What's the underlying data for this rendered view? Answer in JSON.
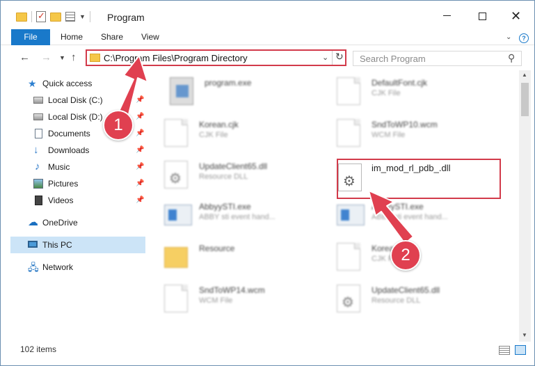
{
  "window": {
    "title": "Program",
    "close_glyph": "✕"
  },
  "ribbon": {
    "file_tab": "File",
    "tabs": [
      "Home",
      "Share",
      "View"
    ]
  },
  "address_bar": {
    "path": "C:\\Program Files\\Program Directory"
  },
  "search": {
    "placeholder": "Search Program"
  },
  "sidebar": {
    "items": [
      {
        "label": "Quick access",
        "icon": "star-icon",
        "pinned": false
      },
      {
        "label": "Local Disk (C:)",
        "icon": "disk-icon",
        "pinned": true
      },
      {
        "label": "Local Disk (D:)",
        "icon": "disk-icon",
        "pinned": true
      },
      {
        "label": "Documents",
        "icon": "documents-icon",
        "pinned": true
      },
      {
        "label": "Downloads",
        "icon": "downloads-icon",
        "pinned": true
      },
      {
        "label": "Music",
        "icon": "music-icon",
        "pinned": true
      },
      {
        "label": "Pictures",
        "icon": "pictures-icon",
        "pinned": true
      },
      {
        "label": "Videos",
        "icon": "videos-icon",
        "pinned": true
      },
      {
        "label": "OneDrive",
        "icon": "onedrive-icon",
        "pinned": false
      },
      {
        "label": "This PC",
        "icon": "this-pc-icon",
        "pinned": false,
        "selected": true
      },
      {
        "label": "Network",
        "icon": "network-icon",
        "pinned": false
      }
    ]
  },
  "files": [
    {
      "name": "program.exe",
      "type": "",
      "icon": "exe-icon"
    },
    {
      "name": "DefaultFont.cjk",
      "type": "CJK File",
      "icon": "file-icon"
    },
    {
      "name": "Korean.cjk",
      "type": "CJK File",
      "icon": "file-icon"
    },
    {
      "name": "SndToWP10.wcm",
      "type": "WCM File",
      "icon": "file-icon"
    },
    {
      "name": "UpdateClient65.dll",
      "type": "Resource DLL",
      "icon": "dll-gear-icon"
    },
    {
      "name": "im_mod_rl_pdb_.dll",
      "type": "",
      "icon": "dll-gear-icon",
      "highlighted": true
    },
    {
      "name": "AbbyySTI.exe",
      "type": "ABBY sti event hand...",
      "icon": "app-icon"
    },
    {
      "name": "AbbyySTI.exe",
      "type": "ABBY sti event hand...",
      "icon": "app-icon"
    },
    {
      "name": "Resource",
      "type": "",
      "icon": "folder-icon"
    },
    {
      "name": "Korean.cjk",
      "type": "CJK File",
      "icon": "file-icon"
    },
    {
      "name": "SndToWP14.wcm",
      "type": "WCM File",
      "icon": "file-icon"
    },
    {
      "name": "UpdateClient65.dll",
      "type": "Resource DLL",
      "icon": "dll-gear-icon"
    }
  ],
  "annotations": {
    "step1": "1",
    "step2": "2",
    "accent_color": "#e04050"
  },
  "status": {
    "item_count": "102 items"
  },
  "colors": {
    "file_tab": "#1979ca",
    "selection": "#cce4f7",
    "highlight": "#d23a4a"
  }
}
